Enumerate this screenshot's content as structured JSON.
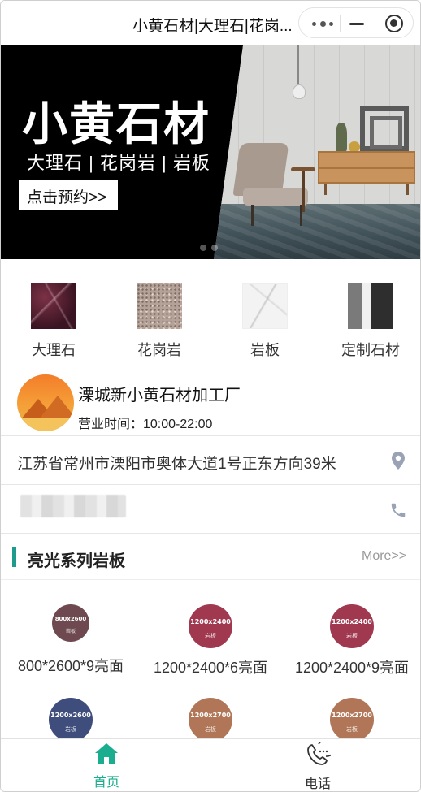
{
  "window": {
    "title": "小黄石材|大理石|花岗..."
  },
  "banner": {
    "headline": "小黄石材",
    "subline": "大理石 | 花岗岩 | 岩板",
    "cta": "点击预约>>",
    "slides": 2,
    "active_slide": 0
  },
  "categories": [
    {
      "label": "大理石",
      "icon": "marble-thumb"
    },
    {
      "label": "花岗岩",
      "icon": "granite-thumb"
    },
    {
      "label": "岩板",
      "icon": "slab-thumb"
    },
    {
      "label": "定制石材",
      "icon": "custom-stone-thumb"
    }
  ],
  "store": {
    "name": "溧城新小黄石材加工厂",
    "hours": "营业时间：10:00-22:00",
    "address": "江苏省常州市溧阳市奥体大道1号正东方向39米"
  },
  "section": {
    "title": "亮光系列岩板",
    "more": "More>>",
    "accent": "#1e9b8c"
  },
  "products": [
    {
      "size": "800x2600",
      "kind": "岩板",
      "label": "800*2600*9亮面",
      "color": "#6e4a50"
    },
    {
      "size": "1200x2400",
      "kind": "岩板",
      "label": "1200*2400*6亮面",
      "color": "#a0384f"
    },
    {
      "size": "1200x2400",
      "kind": "岩板",
      "label": "1200*2400*9亮面",
      "color": "#a0384f"
    },
    {
      "size": "1200x2600",
      "kind": "岩板",
      "label": "",
      "color": "#3f4d7c"
    },
    {
      "size": "1200x2700",
      "kind": "岩板",
      "label": "",
      "color": "#b07657"
    },
    {
      "size": "1200x2700",
      "kind": "岩板",
      "label": "",
      "color": "#b07657"
    }
  ],
  "tabbar": {
    "home": "首页",
    "call": "电话",
    "active_color": "#1aad8f"
  }
}
